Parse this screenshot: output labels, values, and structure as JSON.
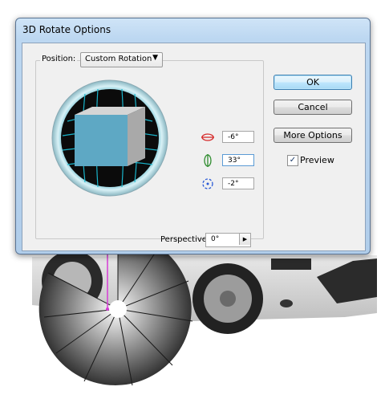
{
  "dialog": {
    "title": "3D Rotate Options",
    "position_label": "Position:",
    "position_value": "Custom Rotation",
    "rotation_x": "-6°",
    "rotation_y": "33°",
    "rotation_z": "-2°",
    "perspective_label": "Perspective:",
    "perspective_value": "0°",
    "ok_label": "OK",
    "cancel_label": "Cancel",
    "more_options_label": "More Options",
    "preview_label": "Preview",
    "preview_checked": true
  },
  "colors": {
    "title_gradient_top": "#cfe4f7",
    "trackball_grid": "#19b3c9",
    "cube_front": "#5ea8c4",
    "cube_side": "#a9a9a9",
    "cube_top": "#d5d5d5",
    "x_axis": "#d62a2a",
    "y_axis": "#2e8c2e",
    "z_axis": "#2a5ad6"
  },
  "icons": [
    "chevron-down-icon",
    "rotate-x-icon",
    "rotate-y-icon",
    "rotate-z-icon",
    "arrow-right-icon",
    "checkmark-icon"
  ]
}
